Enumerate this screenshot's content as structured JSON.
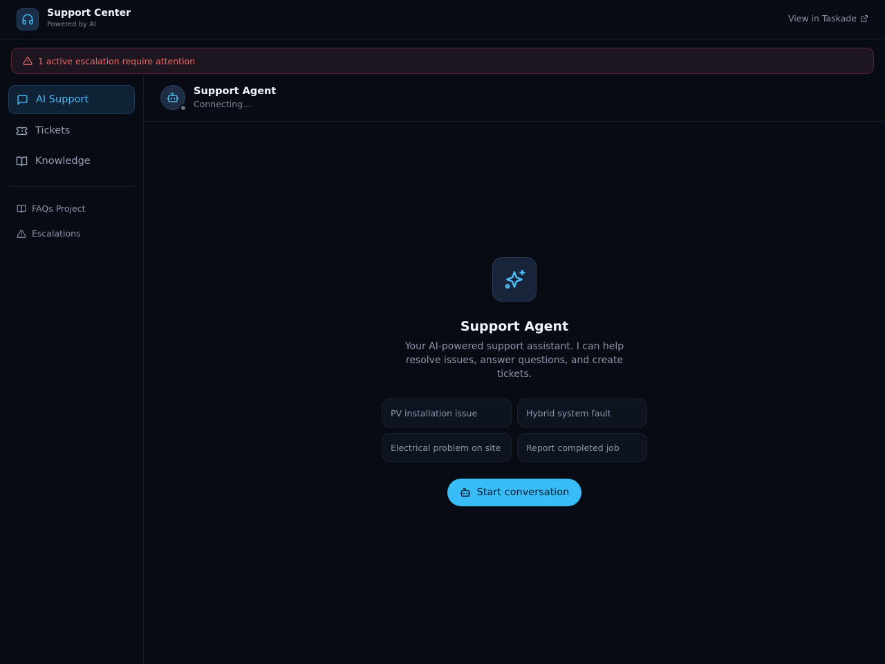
{
  "header": {
    "title": "Support Center",
    "subtitle": "Powered by AI",
    "link_label": "View in Taskade",
    "brand_icon": "headphones-icon"
  },
  "alert": {
    "text": "1 active escalation require attention",
    "icon": "warning-icon"
  },
  "sidebar": {
    "items": [
      {
        "label": "AI Support",
        "icon": "chat-icon",
        "active": true
      },
      {
        "label": "Tickets",
        "icon": "ticket-icon",
        "active": false
      },
      {
        "label": "Knowledge",
        "icon": "book-icon",
        "active": false
      }
    ],
    "links": [
      {
        "label": "FAQs Project",
        "icon": "book-icon"
      },
      {
        "label": "Escalations",
        "icon": "warning-icon"
      }
    ]
  },
  "chat": {
    "agent_name": "Support Agent",
    "agent_status": "Connecting...",
    "hero_title": "Support Agent",
    "hero_description": "Your AI-powered support assistant. I can help resolve issues, answer questions, and create tickets.",
    "suggestions": [
      "PV installation issue",
      "Hybrid system fault",
      "Electrical problem on site",
      "Report completed job"
    ],
    "start_button": "Start conversation"
  },
  "colors": {
    "background": "#080b14",
    "accent": "#38bdf8",
    "alert": "#ef6b6b"
  }
}
